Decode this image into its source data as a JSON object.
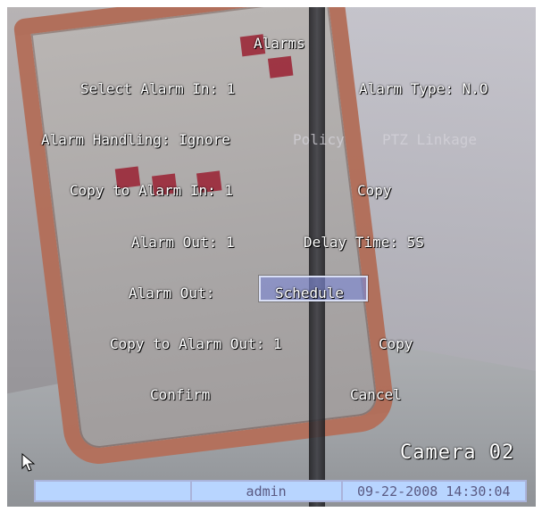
{
  "screen": {
    "title": "Alarms",
    "camera_label": "Camera 02",
    "status_bar": {
      "left": "",
      "user": "admin",
      "datetime": "09-22-2008 14:30:04"
    }
  },
  "alarms": {
    "select_alarm_in_label": "Select Alarm In: 1",
    "alarm_type_label": "Alarm Type: N.O",
    "alarm_handling_label": "Alarm Handling: Ignore",
    "policy_label": "Policy",
    "ptz_linkage_label": "PTZ Linkage",
    "copy_to_alarm_in_label": "Copy to Alarm In: 1",
    "copy_label_1": "Copy",
    "alarm_out_value_label": "Alarm Out: 1",
    "delay_time_label": "Delay Time: 5S",
    "alarm_out_label": "Alarm Out:",
    "schedule_label": "Schedule",
    "copy_to_alarm_out_label": "Copy to Alarm Out: 1",
    "copy_label_2": "Copy",
    "confirm_label": "Confirm",
    "cancel_label": "Cancel"
  },
  "icons": {
    "cursor": "mouse-pointer-icon"
  },
  "colors": {
    "osd_text": "#ffffff",
    "disabled_text": "#d5d3da",
    "selection_fill": "#7e88d2",
    "selection_border": "#d9dff5",
    "status_bar_bg": "#b8d5ff",
    "status_bar_border": "#aab3da",
    "status_bar_text": "#5a5a82"
  }
}
